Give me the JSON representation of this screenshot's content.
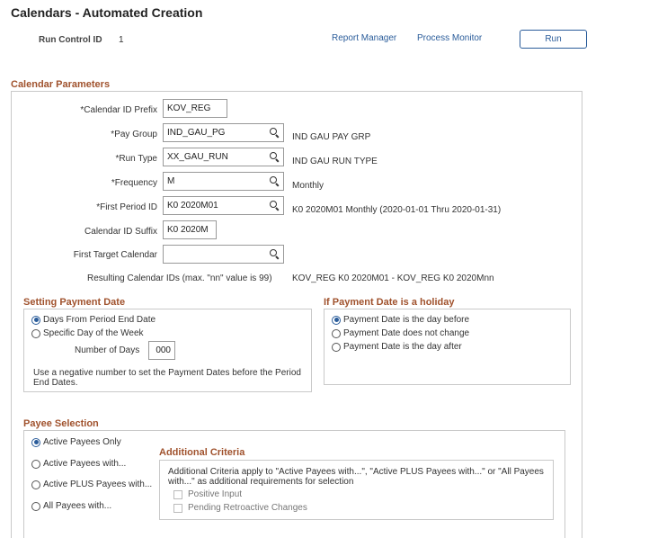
{
  "page": {
    "title": "Calendars - Automated Creation",
    "run_control_label": "Run Control ID",
    "run_control_value": "1",
    "report_manager": "Report Manager",
    "process_monitor": "Process Monitor",
    "run_button": "Run"
  },
  "calendar_parameters": {
    "title": "Calendar Parameters",
    "calendar_id_prefix": {
      "label": "*Calendar ID Prefix",
      "value": "KOV_REG"
    },
    "pay_group": {
      "label": "*Pay Group",
      "value": "IND_GAU_PG",
      "description": "IND GAU PAY GRP"
    },
    "run_type": {
      "label": "*Run Type",
      "value": "XX_GAU_RUN",
      "description": "IND GAU RUN TYPE"
    },
    "frequency": {
      "label": "*Frequency",
      "value": "M",
      "description": "Monthly"
    },
    "first_period_id": {
      "label": "*First Period ID",
      "value": "K0 2020M01",
      "description": "K0 2020M01 Monthly (2020-01-01 Thru 2020-01-31)"
    },
    "calendar_id_suffix": {
      "label": "Calendar ID Suffix",
      "value": "K0 2020M"
    },
    "first_target_calendar": {
      "label": "First Target Calendar",
      "value": ""
    },
    "resulting_ids": {
      "label": "Resulting Calendar IDs (max. \"nn\" value is 99)",
      "value": "KOV_REG K0 2020M01 - KOV_REG K0 2020Mnn"
    }
  },
  "setting_payment_date": {
    "title": "Setting Payment Date",
    "option_days": "Days From Period End Date",
    "option_weekday": "Specific Day of the Week",
    "number_of_days_label": "Number of Days",
    "number_of_days_value": "000",
    "note": "Use a negative number to set the Payment Dates before the Period End Dates."
  },
  "holiday": {
    "title": "If Payment Date is a holiday",
    "option_before": "Payment Date is the day before",
    "option_no_change": "Payment Date does not change",
    "option_after": "Payment Date is the day after"
  },
  "payee_selection": {
    "title": "Payee Selection",
    "option_active_only": "Active Payees Only",
    "option_active_with": "Active Payees with...",
    "option_active_plus": "Active PLUS Payees with...",
    "option_all_with": "All Payees with..."
  },
  "additional_criteria": {
    "title": "Additional Criteria",
    "note": "Additional Criteria apply to \"Active Payees with...\", \"Active PLUS Payees with...\" or \"All Payees with...\" as additional requirements for selection",
    "positive_input": "Positive Input",
    "pending_retro": "Pending Retroactive Changes"
  },
  "colors": {
    "accent": "#2a5c9a",
    "section_title": "#a0522d"
  }
}
